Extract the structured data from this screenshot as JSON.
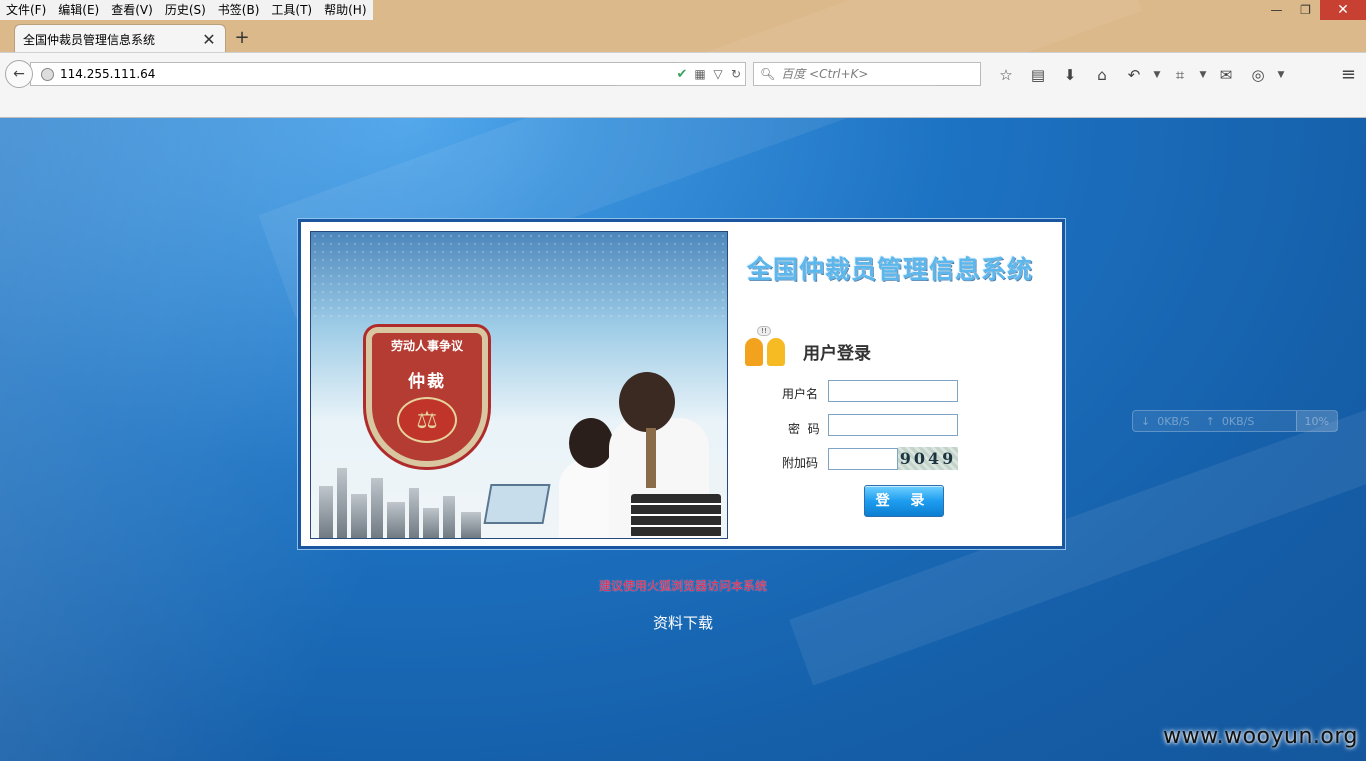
{
  "browser": {
    "menu": [
      "文件(F)",
      "编辑(E)",
      "查看(V)",
      "历史(S)",
      "书签(B)",
      "工具(T)",
      "帮助(H)"
    ],
    "window_controls": {
      "minimize": "—",
      "restore": "❐",
      "close": "✕"
    },
    "tab": {
      "title": "全国仲裁员管理信息系统",
      "close": "✕"
    },
    "new_tab": "+",
    "url": "114.255.111.64",
    "search_placeholder": "百度 <Ctrl+K>",
    "icons": {
      "back": "arrow-left-icon",
      "bookmark": "star-icon",
      "reading_list": "clipboard-icon",
      "download": "download-arrow-icon",
      "home": "home-icon",
      "undo": "undo-icon",
      "crop": "crop-icon",
      "chat": "chat-icon",
      "addon": "addon-icon",
      "menu": "hamburger-menu-icon"
    }
  },
  "page": {
    "system_title": "全国仲裁员管理信息系统",
    "banner": {
      "badge_top": "劳动人事争议",
      "badge_mid": "仲裁"
    },
    "login": {
      "heading": "用户登录",
      "username_label": "用户名",
      "password_label": "密  码",
      "captcha_label": "附加码",
      "captcha_value": "9049",
      "submit": "登 录",
      "username_value": "",
      "password_value": "",
      "captcha_input_value": ""
    },
    "notice": "建议使用火狐浏览器访问本系统",
    "download": "资料下载"
  },
  "net_monitor": {
    "down": "0KB/S",
    "up": "0KB/S",
    "percent": "10%"
  },
  "watermark": "www.wooyun.org",
  "colors": {
    "titlebar": "#dcb98b",
    "page_bg": "#1565b0",
    "notice": "#e8244d",
    "title_text": "#5cb8ec",
    "button": "#1e9df0"
  }
}
